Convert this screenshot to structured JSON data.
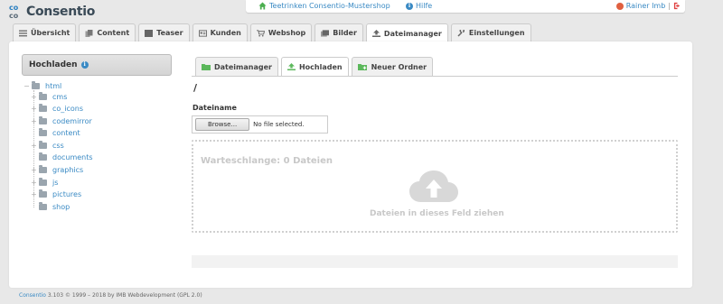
{
  "logo": {
    "mark_letters": [
      "co",
      "co"
    ],
    "text": "Consentio"
  },
  "topbar": {
    "shop_label": "Teetrinken Consentio-Mustershop",
    "help_label": "Hilfe",
    "user_label": "Rainer Imb"
  },
  "main_tabs": [
    {
      "label": "Übersicht",
      "icon": "list-icon"
    },
    {
      "label": "Content",
      "icon": "document-icon"
    },
    {
      "label": "Teaser",
      "icon": "teaser-icon"
    },
    {
      "label": "Kunden",
      "icon": "contact-card-icon"
    },
    {
      "label": "Webshop",
      "icon": "cart-icon"
    },
    {
      "label": "Bilder",
      "icon": "images-icon"
    },
    {
      "label": "Dateimanager",
      "icon": "upload-icon",
      "active": true
    },
    {
      "label": "Einstellungen",
      "icon": "wrench-icon"
    }
  ],
  "left_panel": {
    "title": "Hochladen",
    "tree": {
      "root": "html",
      "children": [
        "cms",
        "co_icons",
        "codemirror",
        "content",
        "css",
        "documents",
        "graphics",
        "js",
        "pictures",
        "shop"
      ]
    }
  },
  "sub_tabs": [
    {
      "label": "Dateimanager",
      "icon": "folder-icon"
    },
    {
      "label": "Hochladen",
      "icon": "upload-icon",
      "active": true
    },
    {
      "label": "Neuer Ordner",
      "icon": "new-folder-icon"
    }
  ],
  "upload": {
    "path": "/",
    "filename_label": "Dateiname",
    "browse_label": "Browse...",
    "no_file_text": "No file selected.",
    "queue_text": "Warteschlange: 0 Dateien",
    "drop_hint": "Dateien in dieses Feld ziehen"
  },
  "footer": {
    "brand": "Consentio",
    "text": " 3.103 © 1999 – 2018 by IMB Webdevelopment (GPL 2.0)"
  },
  "colors": {
    "link": "#3a8ac4",
    "home_icon": "#4caf50",
    "logout_icon": "#e04040",
    "logo_blue": "#2a7fc0"
  }
}
